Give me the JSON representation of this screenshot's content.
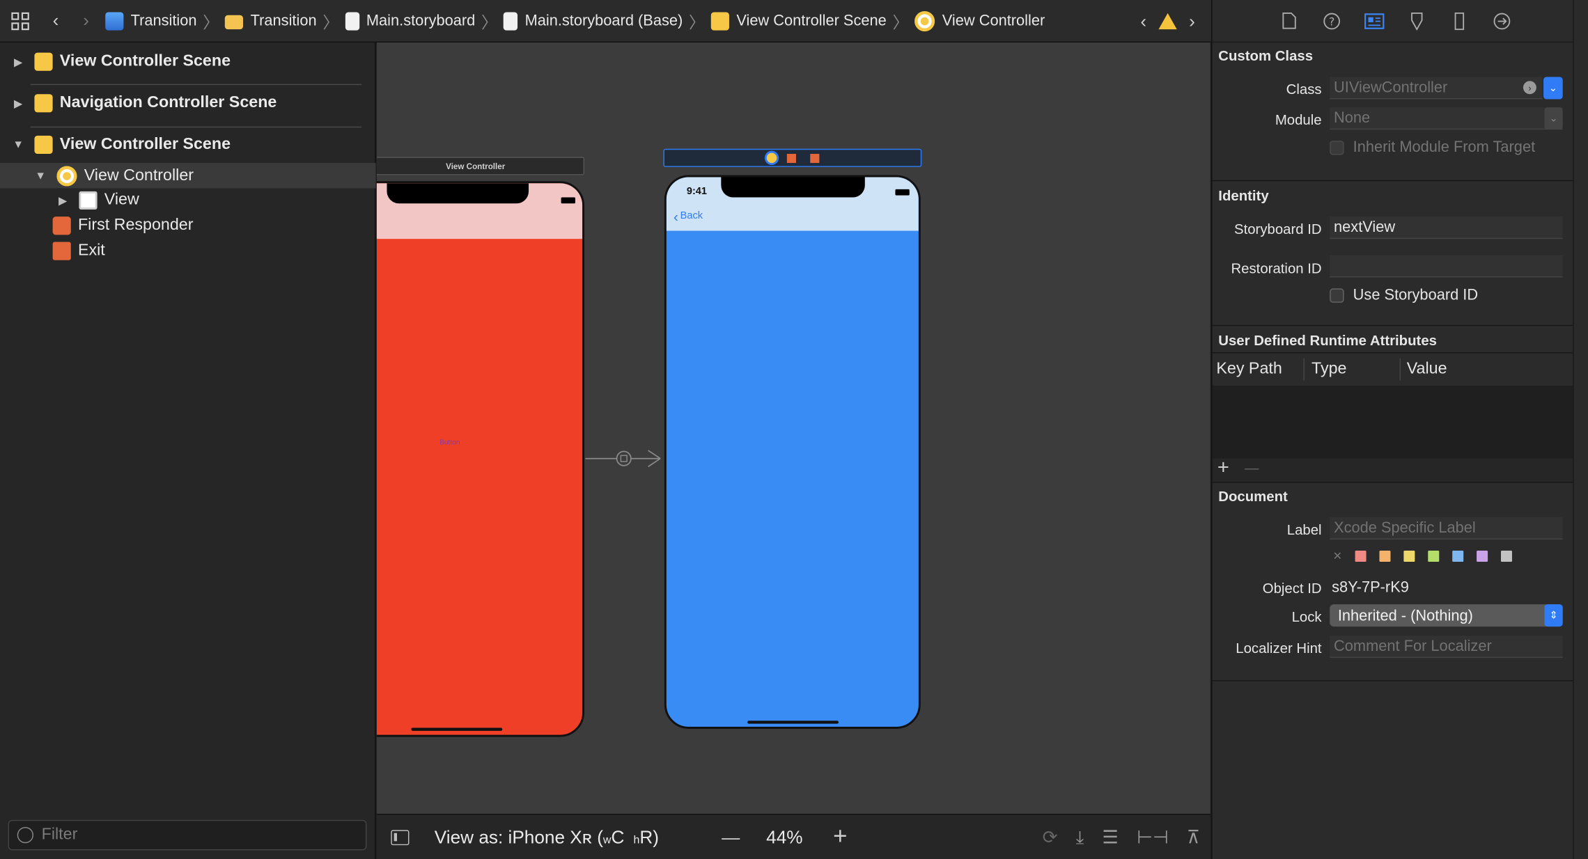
{
  "breadcrumbs": [
    {
      "label": "Transition",
      "icon": "project-icon"
    },
    {
      "label": "Transition",
      "icon": "folder-icon"
    },
    {
      "label": "Main.storyboard",
      "icon": "storyboard-file-icon"
    },
    {
      "label": "Main.storyboard (Base)",
      "icon": "storyboard-file-icon"
    },
    {
      "label": "View Controller Scene",
      "icon": "scene-icon"
    },
    {
      "label": "View Controller",
      "icon": "view-controller-icon"
    }
  ],
  "navigator": {
    "items": [
      {
        "label": "View Controller Scene",
        "disclosure": "▶"
      },
      {
        "label": "Navigation Controller Scene",
        "disclosure": "▶"
      },
      {
        "label": "View Controller Scene",
        "disclosure": "▼"
      },
      {
        "label": "View Controller",
        "disclosure": "▼"
      },
      {
        "label": "View",
        "disclosure": "▶"
      },
      {
        "label": "First Responder"
      },
      {
        "label": "Exit"
      }
    ],
    "filter_placeholder": "Filter"
  },
  "canvas": {
    "left_scene_title": "View Controller",
    "right_phone_time": "9:41",
    "back_label": "Back",
    "button_label": "Button",
    "colors": {
      "left_top": "#f2c6c5",
      "left_body": "#ef4027",
      "right_top": "#cfe3f7",
      "right_body": "#3a8cf5",
      "canvas_bg": "#3c3c3c"
    }
  },
  "canvas_bar": {
    "view_as": "View as: iPhone Xʀ (",
    "view_as_w": "w",
    "view_as_c": "C",
    "view_as_h": "h",
    "view_as_r": "R)",
    "zoom": "44%",
    "zoom_out": "—",
    "zoom_in": "+"
  },
  "inspector": {
    "custom_class": {
      "title": "Custom Class",
      "class_label": "Class",
      "class_placeholder": "UIViewController",
      "module_label": "Module",
      "module_placeholder": "None",
      "inherit_label": "Inherit Module From Target"
    },
    "identity": {
      "title": "Identity",
      "storyboard_id_label": "Storyboard ID",
      "storyboard_id_value": "nextView",
      "restoration_id_label": "Restoration ID",
      "use_storyboard_id_label": "Use Storyboard ID"
    },
    "runtime_attributes": {
      "title": "User Defined Runtime Attributes",
      "col_key_path": "Key Path",
      "col_type": "Type",
      "col_value": "Value",
      "add": "+",
      "remove": "—"
    },
    "document": {
      "title": "Document",
      "label_label": "Label",
      "label_placeholder": "Xcode Specific Label",
      "clear": "✕",
      "swatches": [
        "#f08a84",
        "#f4b26a",
        "#efd86a",
        "#b5dd6a",
        "#7fb8f0",
        "#c9a2e8",
        "#c2c2c2"
      ],
      "object_id_label": "Object ID",
      "object_id_value": "s8Y-7P-rK9",
      "lock_label": "Lock",
      "lock_value": "Inherited - (Nothing)",
      "localizer_label": "Localizer Hint",
      "localizer_placeholder": "Comment For Localizer"
    }
  },
  "accent_color": "#2f7cf6"
}
